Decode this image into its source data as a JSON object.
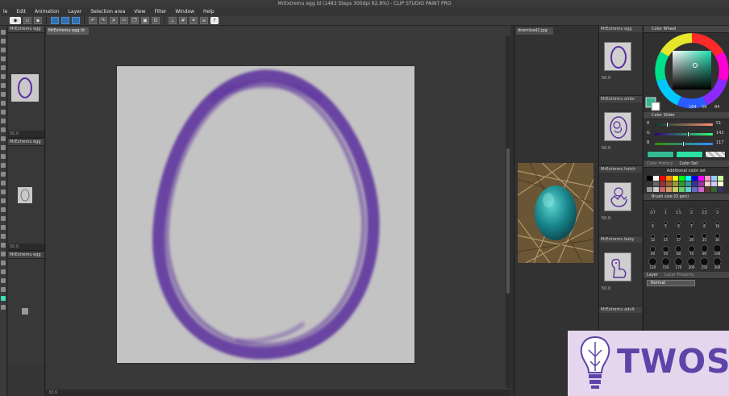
{
  "window": {
    "title": "MrExtremu egg ld (1483 Steps 300dpi 92.8%) - CLIP STUDIO PAINT PRO"
  },
  "menu": {
    "items": [
      "le",
      "Edit",
      "Animation",
      "Layer",
      "Selection area",
      "View",
      "Filter",
      "Window",
      "Help"
    ]
  },
  "canvas": {
    "tab_label": "MrExtremu egg ld",
    "status": "33.6"
  },
  "left_panel": {
    "tabs": [
      "MrExtremu egg",
      "MrExtremu egg",
      "MrExtremu egg"
    ],
    "footers": [
      "50.0",
      "50.0"
    ]
  },
  "reference": {
    "tab_label": "download2.jpg"
  },
  "frames": {
    "items": [
      {
        "title": "MrExtremu egg",
        "num": "50.0"
      },
      {
        "title": "MrExtremu embr",
        "num": "50.0"
      },
      {
        "title": "MrExtremu hatch",
        "num": "50.0"
      },
      {
        "title": "MrExtremu baby",
        "num": "50.0"
      },
      {
        "title": "MrExtremu adult",
        "num": ""
      }
    ]
  },
  "right_panel": {
    "color_wheel_header": "Color Wheel",
    "hsv_values": [
      "164",
      "59",
      "84"
    ],
    "color_slider_header": "Color Slider",
    "rgb_values": [
      "51",
      "142",
      "117"
    ],
    "color_set_tabs": [
      "Color History",
      "Color Set"
    ],
    "color_set_name": "Additional color set",
    "brush_size_header": "Brush size (D pen)",
    "brush_sizes": [
      "0.7",
      "1",
      "1.5",
      "2",
      "2.5",
      "3",
      "4",
      "5",
      "6",
      "7",
      "8",
      "10",
      "12",
      "15",
      "17",
      "20",
      "25",
      "30",
      "40",
      "50",
      "60",
      "70",
      "80",
      "100",
      "120",
      "150",
      "170",
      "200",
      "250",
      "300"
    ],
    "layer_tabs": [
      "Layer",
      "Layer Property"
    ],
    "blend_mode": "Normal"
  },
  "watermark": {
    "text": "TWOS"
  },
  "colors": {
    "main": "#33ba93",
    "sub": "#ffffff",
    "egg_stroke": "#5b2f9c",
    "watermark_bg": "#e5d6ee",
    "watermark_text": "#5e44a8"
  }
}
